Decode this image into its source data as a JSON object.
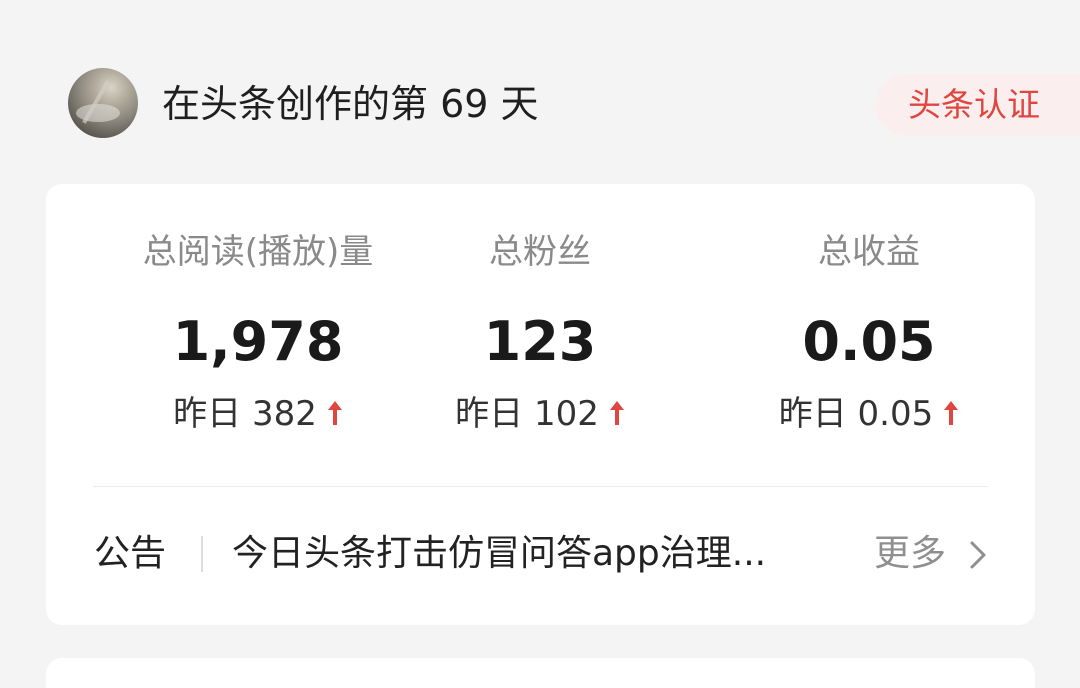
{
  "header": {
    "title": "在头条创作的第 69 天",
    "badge": "头条认证"
  },
  "stats": [
    {
      "label": "总阅读(播放)量",
      "value": "1,978",
      "delta": "昨日 382",
      "trend_icon": "arrow-up-icon"
    },
    {
      "label": "总粉丝",
      "value": "123",
      "delta": "昨日 102",
      "trend_icon": "arrow-up-icon"
    },
    {
      "label": "总收益",
      "value": "0.05",
      "delta": "昨日 0.05",
      "trend_icon": "arrow-up-icon"
    }
  ],
  "notice": {
    "label": "公告",
    "text": "今日头条打击仿冒问答app治理...",
    "more": "更多",
    "more_icon": "chevron-right-icon"
  },
  "colors": {
    "background": "#f4f4f4",
    "card": "#ffffff",
    "accent_red": "#e0463f",
    "badge_bg": "#fbeeee",
    "muted_text": "#8a8a8a"
  }
}
